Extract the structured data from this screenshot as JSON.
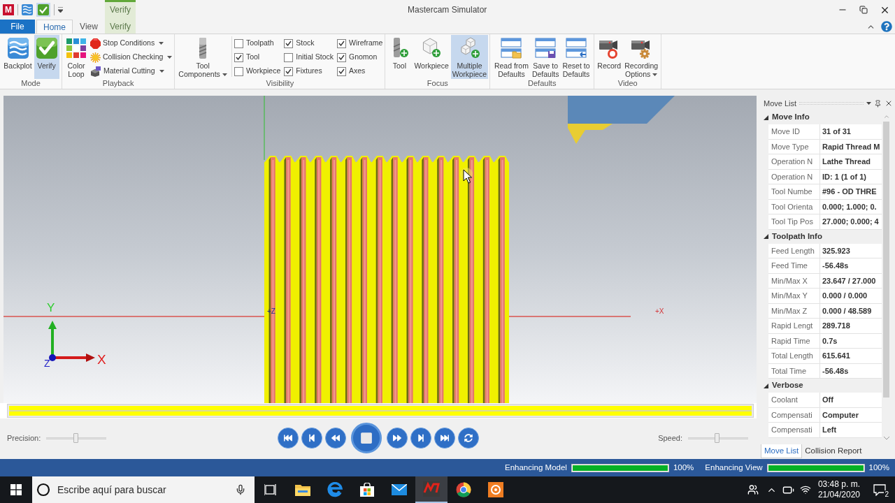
{
  "title_bar": {
    "logo_text": "M",
    "title": "Mastercam Simulator",
    "contextual_group": "Verify"
  },
  "ribbon_tabs": [
    {
      "label": "File",
      "kind": "file",
      "selected": false
    },
    {
      "label": "Home",
      "kind": "normal",
      "selected": true
    },
    {
      "label": "View",
      "kind": "normal",
      "selected": false
    },
    {
      "label": "Verify",
      "kind": "contextual",
      "selected": false
    }
  ],
  "ribbon_groups": [
    {
      "label": "Mode",
      "large_buttons": [
        {
          "label": "Backplot",
          "selected": false,
          "dropdown": false
        },
        {
          "label": "Verify",
          "selected": true,
          "dropdown": false
        }
      ]
    },
    {
      "label": "Playback",
      "large_buttons": [
        {
          "label": "Color\nLoop",
          "selected": false,
          "dropdown": false
        }
      ],
      "small_buttons": [
        {
          "label": "Stop Conditions",
          "dropdown": true
        },
        {
          "label": "Collision Checking",
          "dropdown": true
        },
        {
          "label": "Material Cutting",
          "dropdown": true
        }
      ]
    },
    {
      "label": "Visibility",
      "large_buttons": [
        {
          "label": "Tool\nComponents",
          "selected": false,
          "dropdown": true
        }
      ],
      "checkboxes": [
        {
          "label": "Toolpath",
          "checked": false
        },
        {
          "label": "Tool",
          "checked": true
        },
        {
          "label": "Workpiece",
          "checked": false
        },
        {
          "label": "Stock",
          "checked": true
        },
        {
          "label": "Initial Stock",
          "checked": false
        },
        {
          "label": "Fixtures",
          "checked": true
        },
        {
          "label": "Wireframe",
          "checked": true
        },
        {
          "label": "Gnomon",
          "checked": true
        },
        {
          "label": "Axes",
          "checked": true
        }
      ]
    },
    {
      "label": "Focus",
      "large_buttons": [
        {
          "label": "Tool",
          "selected": false,
          "dropdown": false
        },
        {
          "label": "Workpiece",
          "selected": false,
          "dropdown": false
        },
        {
          "label": "Multiple\nWorkpiece",
          "selected": true,
          "dropdown": false
        }
      ]
    },
    {
      "label": "Defaults",
      "large_buttons": [
        {
          "label": "Read from\nDefaults",
          "selected": false,
          "dropdown": false
        },
        {
          "label": "Save to\nDefaults",
          "selected": false,
          "dropdown": false
        },
        {
          "label": "Reset to\nDefaults",
          "selected": false,
          "dropdown": false
        }
      ]
    },
    {
      "label": "Video",
      "large_buttons": [
        {
          "label": "Record",
          "selected": false,
          "dropdown": false
        },
        {
          "label": "Recording\nOptions",
          "selected": false,
          "dropdown": true
        }
      ]
    }
  ],
  "viewport": {
    "z_axis_label": "+Z",
    "x_axis_label": "+X",
    "gnomon": {
      "y_label": "Y",
      "x_label": "X",
      "z_label": "Z"
    }
  },
  "timeline": {
    "level": 1
  },
  "playback_bar": {
    "precision": {
      "label": "Precision:",
      "level": 0.49
    },
    "speed": {
      "label": "Speed:",
      "level": 0.48
    }
  },
  "move_list": {
    "title": "Move List",
    "sections": [
      {
        "title": "Move Info",
        "expanded": true,
        "rows": [
          {
            "name": "Move ID",
            "value": "31 of 31"
          },
          {
            "name": "Move Type",
            "value": "Rapid Thread M"
          },
          {
            "name": "Operation N",
            "value": "Lathe Thread"
          },
          {
            "name": "Operation N",
            "value": "ID: 1 (1 of 1)"
          },
          {
            "name": "Tool Numbe",
            "value": "#96 - OD THRE"
          },
          {
            "name": "Tool Orienta",
            "value": "0.000; 1.000; 0."
          },
          {
            "name": "Tool Tip Pos",
            "value": "27.000; 0.000; 4"
          }
        ]
      },
      {
        "title": "Toolpath Info",
        "expanded": true,
        "rows": [
          {
            "name": "Feed Length",
            "value": "325.923"
          },
          {
            "name": "Feed Time",
            "value": "-56.48s"
          },
          {
            "name": "Min/Max X",
            "value": "23.647 / 27.000"
          },
          {
            "name": "Min/Max Y",
            "value": "0.000 / 0.000"
          },
          {
            "name": "Min/Max Z",
            "value": "0.000 / 48.589"
          },
          {
            "name": "Rapid Lengt",
            "value": "289.718"
          },
          {
            "name": "Rapid Time",
            "value": "0.7s"
          },
          {
            "name": "Total Length",
            "value": "615.641"
          },
          {
            "name": "Total Time",
            "value": "-56.48s"
          }
        ]
      },
      {
        "title": "Verbose",
        "expanded": true,
        "rows": [
          {
            "name": "Coolant",
            "value": "Off"
          },
          {
            "name": "Compensati",
            "value": "Computer"
          },
          {
            "name": "Compensati",
            "value": "Left"
          }
        ]
      }
    ],
    "tabs": [
      {
        "label": "Move List",
        "selected": true
      },
      {
        "label": "Collision Report",
        "selected": false
      }
    ]
  },
  "status_bar": [
    {
      "label": "Enhancing Model",
      "level": 1,
      "reading": "100%"
    },
    {
      "label": "Enhancing View",
      "level": 1,
      "reading": "100%"
    }
  ],
  "taskbar": {
    "search_placeholder": "Escribe aquí para buscar",
    "apps": [
      {
        "selected": false
      },
      {
        "selected": false
      },
      {
        "selected": false
      },
      {
        "selected": false
      },
      {
        "selected": true
      },
      {
        "selected": false
      },
      {
        "selected": false
      }
    ],
    "clock": {
      "time": "03:48 p. m.",
      "date": "21/04/2020"
    },
    "notification_count": "2"
  }
}
